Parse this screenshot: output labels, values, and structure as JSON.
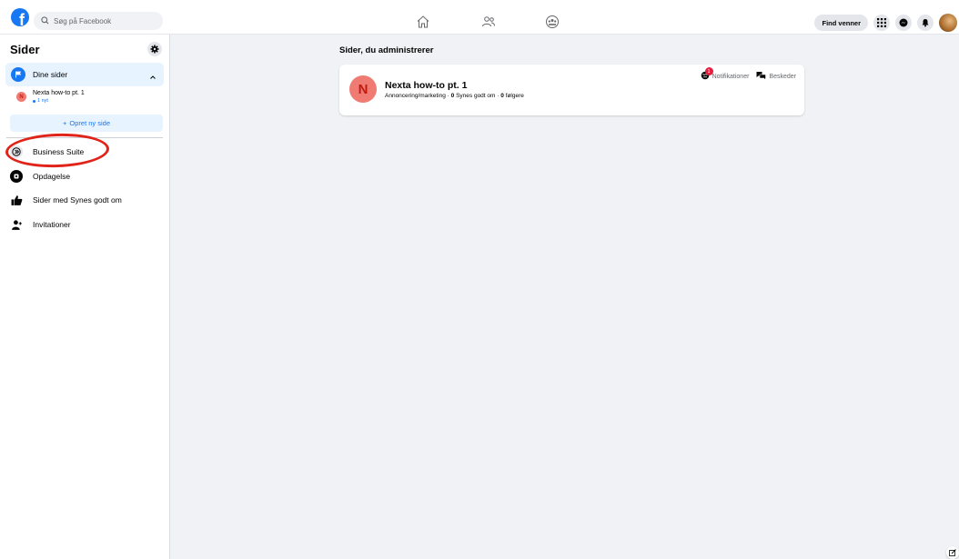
{
  "header": {
    "search_placeholder": "Søg på Facebook",
    "find_friends_label": "Find venner",
    "logo_letter": "f",
    "icons": [
      "home-icon",
      "friends-icon",
      "groups-icon",
      "menu-grid-icon",
      "messenger-icon",
      "notifications-icon"
    ]
  },
  "sidebar": {
    "title": "Sider",
    "your_pages_label": "Dine sider",
    "page": {
      "avatar_letter": "N",
      "name": "Nexta how-to pt. 1",
      "new_count": "1 nyt"
    },
    "create_label": "Opret ny side",
    "create_prefix": "+",
    "menu": [
      {
        "label": "Business Suite",
        "icon": "business-suite-icon"
      },
      {
        "label": "Opdagelse",
        "icon": "discover-icon"
      },
      {
        "label": "Sider med Synes godt om",
        "icon": "thumbs-up-icon"
      },
      {
        "label": "Invitationer",
        "icon": "invite-icon"
      }
    ]
  },
  "main": {
    "section_title": "Sider, du administrerer",
    "card": {
      "avatar_letter": "N",
      "name": "Nexta how-to pt. 1",
      "category": "Annoncering/marketing",
      "likes_count": "0",
      "likes_label": "Synes godt om",
      "followers_count": "0",
      "followers_label": "følgere",
      "separator": " · ",
      "notifications_label": "Notifikationer",
      "notifications_badge": "1",
      "messages_label": "Beskeder"
    }
  },
  "colors": {
    "accent": "#1877f2",
    "highlight_oval": "#e0241a",
    "badge": "#e41e3f",
    "page_avatar": "#ef7b73"
  }
}
